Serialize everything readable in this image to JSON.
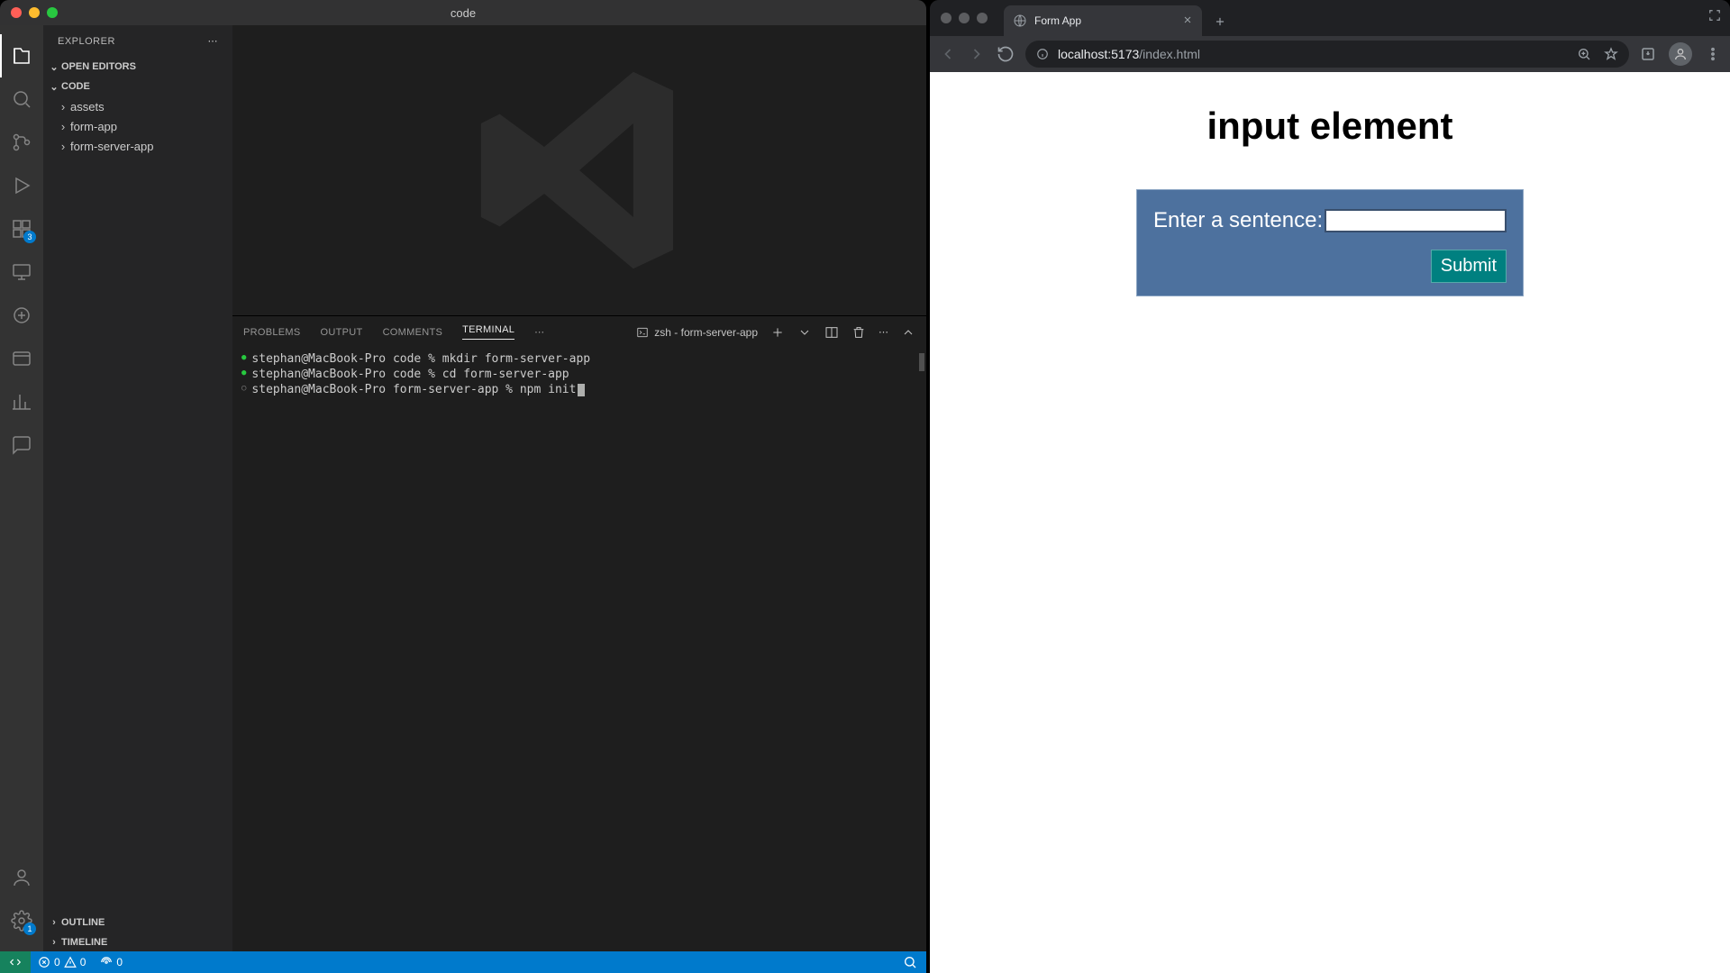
{
  "vscode": {
    "title": "code",
    "explorer_label": "EXPLORER",
    "sections": {
      "open_editors": "OPEN EDITORS",
      "root": "CODE",
      "outline": "OUTLINE",
      "timeline": "TIMELINE"
    },
    "tree": [
      {
        "name": "assets"
      },
      {
        "name": "form-app"
      },
      {
        "name": "form-server-app"
      }
    ],
    "activity_badge": "3",
    "panel_tabs": {
      "problems": "PROBLEMS",
      "output": "OUTPUT",
      "comments": "COMMENTS",
      "terminal": "TERMINAL"
    },
    "terminal_label": "zsh - form-server-app",
    "terminal_lines": [
      {
        "bullet": "green",
        "text": "stephan@MacBook-Pro code % mkdir form-server-app"
      },
      {
        "bullet": "green",
        "text": "stephan@MacBook-Pro code % cd form-server-app"
      },
      {
        "bullet": "gray",
        "text": "stephan@MacBook-Pro form-server-app % npm init",
        "cursor": true
      }
    ],
    "status": {
      "errors": "0",
      "warnings": "0",
      "ports": "0"
    }
  },
  "browser": {
    "tab_title": "Form App",
    "url_host": "localhost:5173",
    "url_path": "/index.html",
    "page": {
      "heading": "input element",
      "label": "Enter a sentence:",
      "submit": "Submit"
    }
  }
}
